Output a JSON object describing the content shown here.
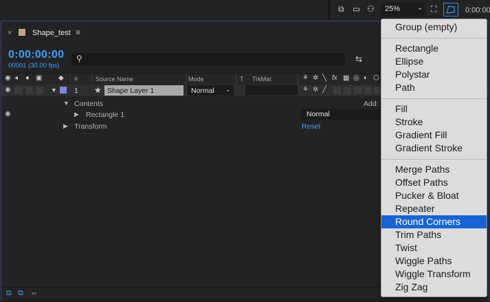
{
  "viewer_bar": {
    "zoom": "25%",
    "timecode": "0:00:00"
  },
  "tab": {
    "close": "×",
    "title": "Shape_test",
    "menu": "≡"
  },
  "timeline": {
    "timecode": "0:00:00:00",
    "frames": "00001 (30.00 fps)",
    "search_placeholder": ""
  },
  "columns": {
    "number": "#",
    "source_name": "Source Name",
    "mode": "Mode",
    "t": "T",
    "trkmat": "TrkMat",
    "fx": "fx"
  },
  "layer": {
    "index": "1",
    "name": "Shape Layer 1",
    "mode": "Normal",
    "color": "#7a87d8"
  },
  "contents": {
    "label": "Contents",
    "add_label": "Add:",
    "rectangle_label": "Rectangle 1",
    "rectangle_blend": "Normal",
    "transform_label": "Transform",
    "reset_label": "Reset"
  },
  "menu": {
    "groups": [
      [
        "Group (empty)"
      ],
      [
        "Rectangle",
        "Ellipse",
        "Polystar",
        "Path"
      ],
      [
        "Fill",
        "Stroke",
        "Gradient Fill",
        "Gradient Stroke"
      ],
      [
        "Merge Paths",
        "Offset Paths",
        "Pucker & Bloat",
        "Repeater",
        "Round Corners",
        "Trim Paths",
        "Twist",
        "Wiggle Paths",
        "Wiggle Transform",
        "Zig Zag"
      ]
    ],
    "selected": "Round Corners",
    "highlight_color": "#1864d4"
  },
  "colors": {
    "accent": "#3fa0ff",
    "panel_border": "#3c4a8a"
  }
}
